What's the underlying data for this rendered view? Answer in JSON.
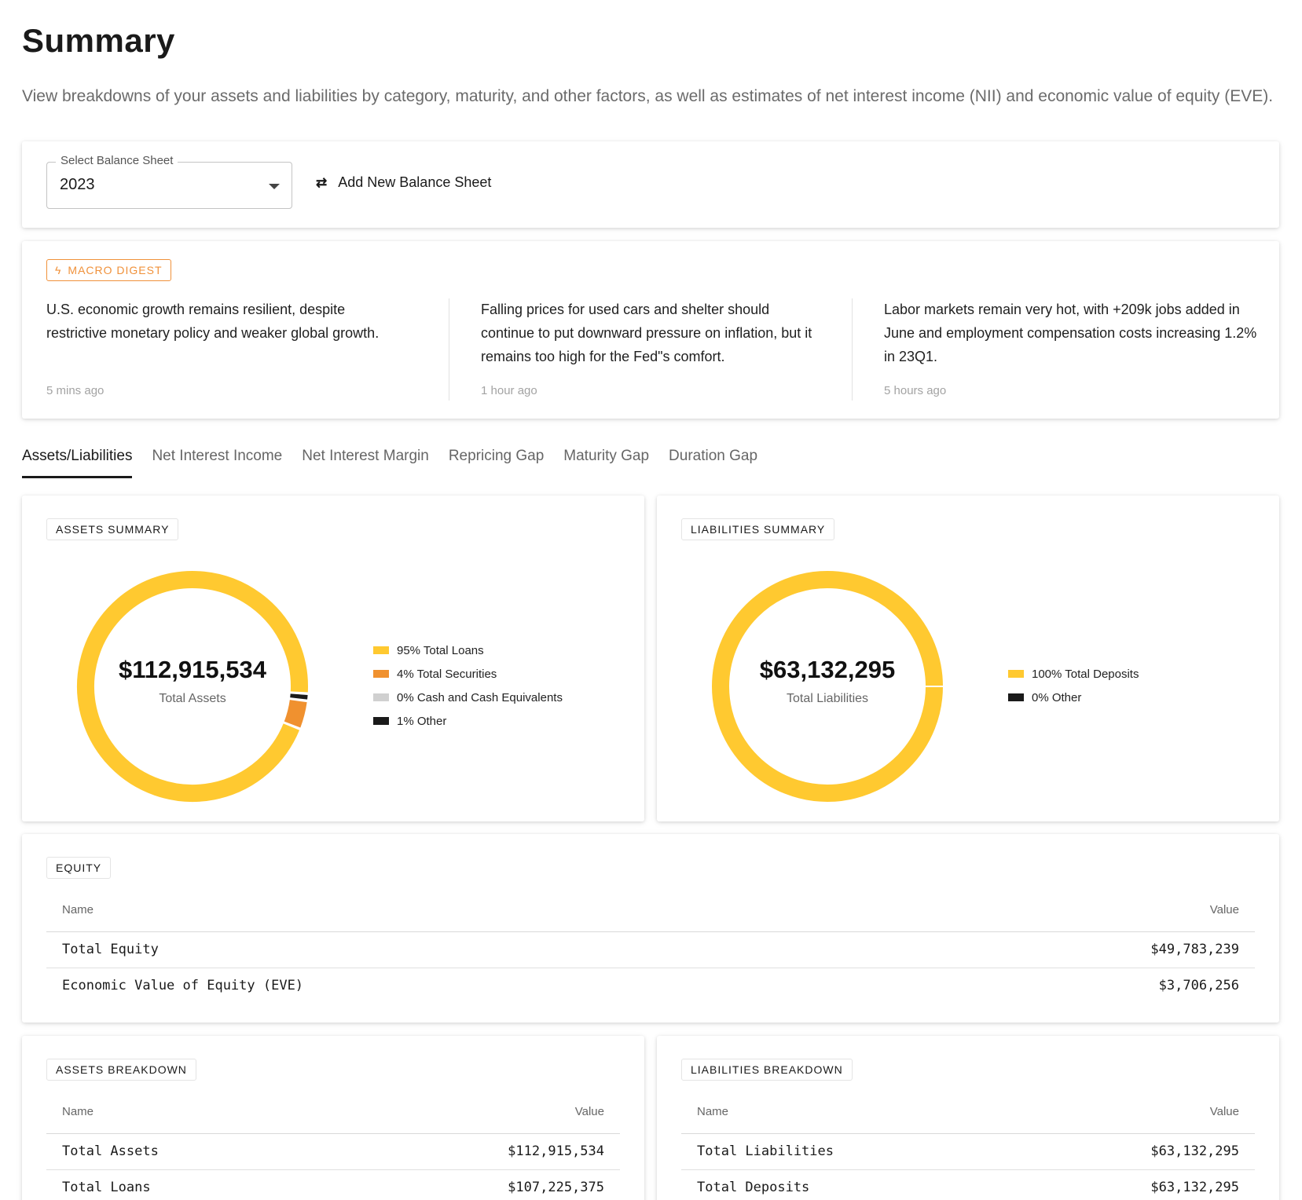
{
  "page": {
    "title": "Summary",
    "description": "View breakdowns of your assets and liabilities by category, maturity, and other factors, as well as estimates of net interest income (NII) and economic value of equity (EVE)."
  },
  "selector": {
    "label": "Select Balance Sheet",
    "value": "2023",
    "add_label": "Add New Balance Sheet"
  },
  "macro": {
    "badge": "MACRO DIGEST",
    "items": [
      {
        "text": "U.S. economic growth remains resilient, despite restrictive monetary policy and weaker global growth.",
        "time": "5 mins ago"
      },
      {
        "text": "Falling prices for used cars and shelter should continue to put downward pressure on inflation, but it remains too high for the Fed\"s comfort.",
        "time": "1 hour ago"
      },
      {
        "text": "Labor markets remain very hot, with +209k jobs added in June and employment compensation costs increasing 1.2% in 23Q1.",
        "time": "5 hours ago"
      }
    ]
  },
  "tabs": [
    "Assets/Liabilities",
    "Net Interest Income",
    "Net Interest Margin",
    "Repricing Gap",
    "Maturity Gap",
    "Duration Gap"
  ],
  "colors": {
    "loans": "#FFC930",
    "securities": "#F0912F",
    "cash": "#D0D0D0",
    "other": "#1A1A1A",
    "accent": "#F0913A"
  },
  "chart_data": [
    {
      "type": "pie",
      "title": "ASSETS SUMMARY",
      "center_value": "$112,915,534",
      "center_label": "Total Assets",
      "series": [
        {
          "name": "Total Loans",
          "value": 95,
          "label": "95% Total Loans",
          "color": "#FFC930"
        },
        {
          "name": "Total Securities",
          "value": 4,
          "label": "4% Total Securities",
          "color": "#F0912F"
        },
        {
          "name": "Cash and Cash Equivalents",
          "value": 0,
          "label": "0% Cash and Cash Equivalents",
          "color": "#D0D0D0"
        },
        {
          "name": "Other",
          "value": 1,
          "label": "1% Other",
          "color": "#1A1A1A"
        }
      ]
    },
    {
      "type": "pie",
      "title": "LIABILITIES SUMMARY",
      "center_value": "$63,132,295",
      "center_label": "Total Liabilities",
      "series": [
        {
          "name": "Total Deposits",
          "value": 100,
          "label": "100% Total Deposits",
          "color": "#FFC930"
        },
        {
          "name": "Other",
          "value": 0,
          "label": "0% Other",
          "color": "#1A1A1A"
        }
      ]
    }
  ],
  "equity": {
    "title": "EQUITY",
    "headers": {
      "name": "Name",
      "value": "Value"
    },
    "rows": [
      {
        "name": "Total Equity",
        "value": "$49,783,239"
      },
      {
        "name": "Economic Value of Equity (EVE)",
        "value": "$3,706,256"
      }
    ]
  },
  "assets_breakdown": {
    "title": "ASSETS BREAKDOWN",
    "headers": {
      "name": "Name",
      "value": "Value"
    },
    "rows": [
      {
        "name": "Total Assets",
        "value": "$112,915,534"
      },
      {
        "name": "Total Loans",
        "value": "$107,225,375"
      }
    ]
  },
  "liabilities_breakdown": {
    "title": "LIABILITIES BREAKDOWN",
    "headers": {
      "name": "Name",
      "value": "Value"
    },
    "rows": [
      {
        "name": "Total Liabilities",
        "value": "$63,132,295"
      },
      {
        "name": "Total Deposits",
        "value": "$63,132,295"
      }
    ]
  }
}
